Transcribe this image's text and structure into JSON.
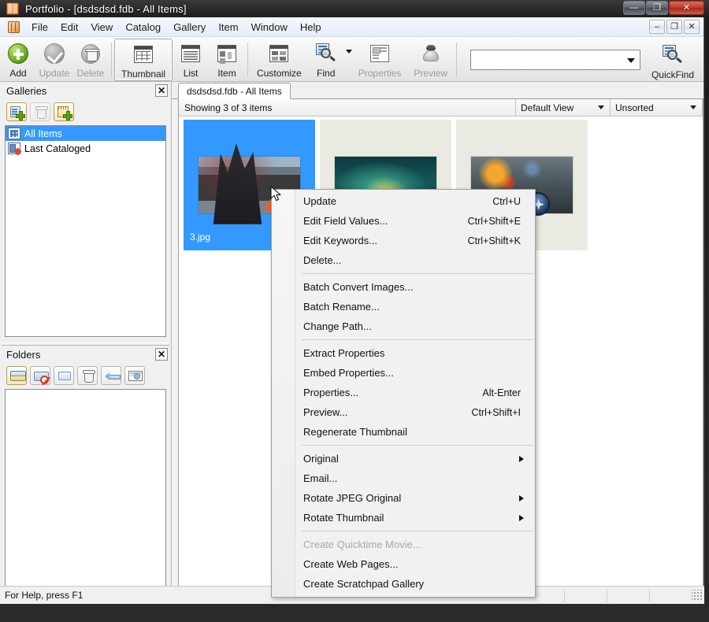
{
  "os_window": {
    "title": "Portfolio - [dsdsdsd.fdb - All Items]",
    "app_icon": "portfolio-app-icon",
    "minimize": "—",
    "maximize": "❐",
    "close": "✕"
  },
  "menubar": {
    "items": [
      {
        "label": "File"
      },
      {
        "label": "Edit"
      },
      {
        "label": "View"
      },
      {
        "label": "Catalog"
      },
      {
        "label": "Gallery"
      },
      {
        "label": "Item"
      },
      {
        "label": "Window"
      },
      {
        "label": "Help"
      }
    ],
    "mdi_buttons": {
      "minimize": "–",
      "restore": "❐",
      "close": "✕"
    }
  },
  "toolbar": {
    "buttons": [
      {
        "label": "Add",
        "icon": "add-circle-icon",
        "state": "enabled"
      },
      {
        "label": "Update",
        "icon": "check-circle-icon",
        "state": "disabled"
      },
      {
        "label": "Delete",
        "icon": "trash-circle-icon",
        "state": "disabled"
      },
      {
        "label": "Thumbnail",
        "icon": "grid-view-icon",
        "state": "active"
      },
      {
        "label": "List",
        "icon": "list-view-icon",
        "state": "enabled"
      },
      {
        "label": "Item",
        "icon": "item-view-icon",
        "state": "enabled"
      },
      {
        "label": "Customize",
        "icon": "customize-icon",
        "state": "enabled"
      },
      {
        "label": "Find",
        "icon": "find-magnifier-icon",
        "state": "enabled"
      },
      {
        "label": "Properties",
        "icon": "properties-icon",
        "state": "disabled"
      },
      {
        "label": "Preview",
        "icon": "preview-icon",
        "state": "disabled"
      }
    ],
    "quickfind": {
      "value": "",
      "placeholder": "",
      "label": "QuickFind",
      "icon": "quickfind-magnifier-icon"
    }
  },
  "sidebar": {
    "galleries_panel": {
      "title": "Galleries",
      "close_label": "✕",
      "tools": [
        {
          "name": "new-gallery",
          "icon": "new-gallery-icon"
        },
        {
          "name": "delete-gallery",
          "icon": "trash-icon"
        },
        {
          "name": "new-gallery-folder",
          "icon": "new-gallery-folder-icon"
        }
      ],
      "items": [
        {
          "label": "All Items",
          "icon": "all-items-icon",
          "selected": true
        },
        {
          "label": "Last Cataloged",
          "icon": "last-cataloged-icon",
          "selected": false
        }
      ]
    },
    "folders_panel": {
      "title": "Folders",
      "close_label": "✕",
      "tools": [
        {
          "name": "add-watched-folder",
          "icon": "folder-add-icon"
        },
        {
          "name": "stop-watching-folder",
          "icon": "folder-block-icon"
        },
        {
          "name": "open-folder",
          "icon": "folder-open-icon"
        },
        {
          "name": "delete-folder",
          "icon": "trash-icon"
        },
        {
          "name": "move-folder",
          "icon": "arrow-left-icon"
        },
        {
          "name": "folder-options",
          "icon": "folder-settings-icon"
        }
      ],
      "items": []
    }
  },
  "content": {
    "tab": {
      "label": "dsdsdsd.fdb - All Items"
    },
    "doc_toolbar": {
      "showing": "Showing 3 of 3 items",
      "view_select": {
        "value": "Default View"
      },
      "sort_select": {
        "value": "Unsorted"
      }
    },
    "thumbnails": [
      {
        "name": "3.jpg",
        "selected": true,
        "art": "t1-img"
      },
      {
        "name": "",
        "selected": false,
        "art": "t2-img"
      },
      {
        "name": "",
        "selected": false,
        "art": "t3-img"
      }
    ]
  },
  "context_menu": {
    "groups": [
      [
        {
          "label": "Update",
          "accel": "Ctrl+U",
          "submenu": false,
          "disabled": false
        },
        {
          "label": "Edit Field Values...",
          "accel": "Ctrl+Shift+E",
          "submenu": false,
          "disabled": false
        },
        {
          "label": "Edit Keywords...",
          "accel": "Ctrl+Shift+K",
          "submenu": false,
          "disabled": false
        },
        {
          "label": "Delete...",
          "accel": "",
          "submenu": false,
          "disabled": false
        }
      ],
      [
        {
          "label": "Batch Convert Images...",
          "accel": "",
          "submenu": false,
          "disabled": false
        },
        {
          "label": "Batch Rename...",
          "accel": "",
          "submenu": false,
          "disabled": false
        },
        {
          "label": "Change Path...",
          "accel": "",
          "submenu": false,
          "disabled": false
        }
      ],
      [
        {
          "label": "Extract Properties",
          "accel": "",
          "submenu": false,
          "disabled": false
        },
        {
          "label": "Embed Properties...",
          "accel": "",
          "submenu": false,
          "disabled": false
        },
        {
          "label": "Properties...",
          "accel": "Alt-Enter",
          "submenu": false,
          "disabled": false
        },
        {
          "label": "Preview...",
          "accel": "Ctrl+Shift+I",
          "submenu": false,
          "disabled": false
        },
        {
          "label": "Regenerate Thumbnail",
          "accel": "",
          "submenu": false,
          "disabled": false
        }
      ],
      [
        {
          "label": "Original",
          "accel": "",
          "submenu": true,
          "disabled": false
        },
        {
          "label": "Email...",
          "accel": "",
          "submenu": false,
          "disabled": false
        },
        {
          "label": "Rotate JPEG Original",
          "accel": "",
          "submenu": true,
          "disabled": false
        },
        {
          "label": "Rotate Thumbnail",
          "accel": "",
          "submenu": true,
          "disabled": false
        }
      ],
      [
        {
          "label": "Create Quicktime Movie...",
          "accel": "",
          "submenu": false,
          "disabled": true
        },
        {
          "label": "Create Web Pages...",
          "accel": "",
          "submenu": false,
          "disabled": false
        },
        {
          "label": "Create Scratchpad Gallery",
          "accel": "",
          "submenu": false,
          "disabled": false
        }
      ]
    ]
  },
  "statusbar": {
    "message": "For Help, press F1"
  },
  "colors": {
    "selection_blue": "#3399ff",
    "thumb_bg": "#eaeae2",
    "window_chrome": "#f0f0f0",
    "accent_green": "#63a80f",
    "close_red": "#c0392b"
  }
}
